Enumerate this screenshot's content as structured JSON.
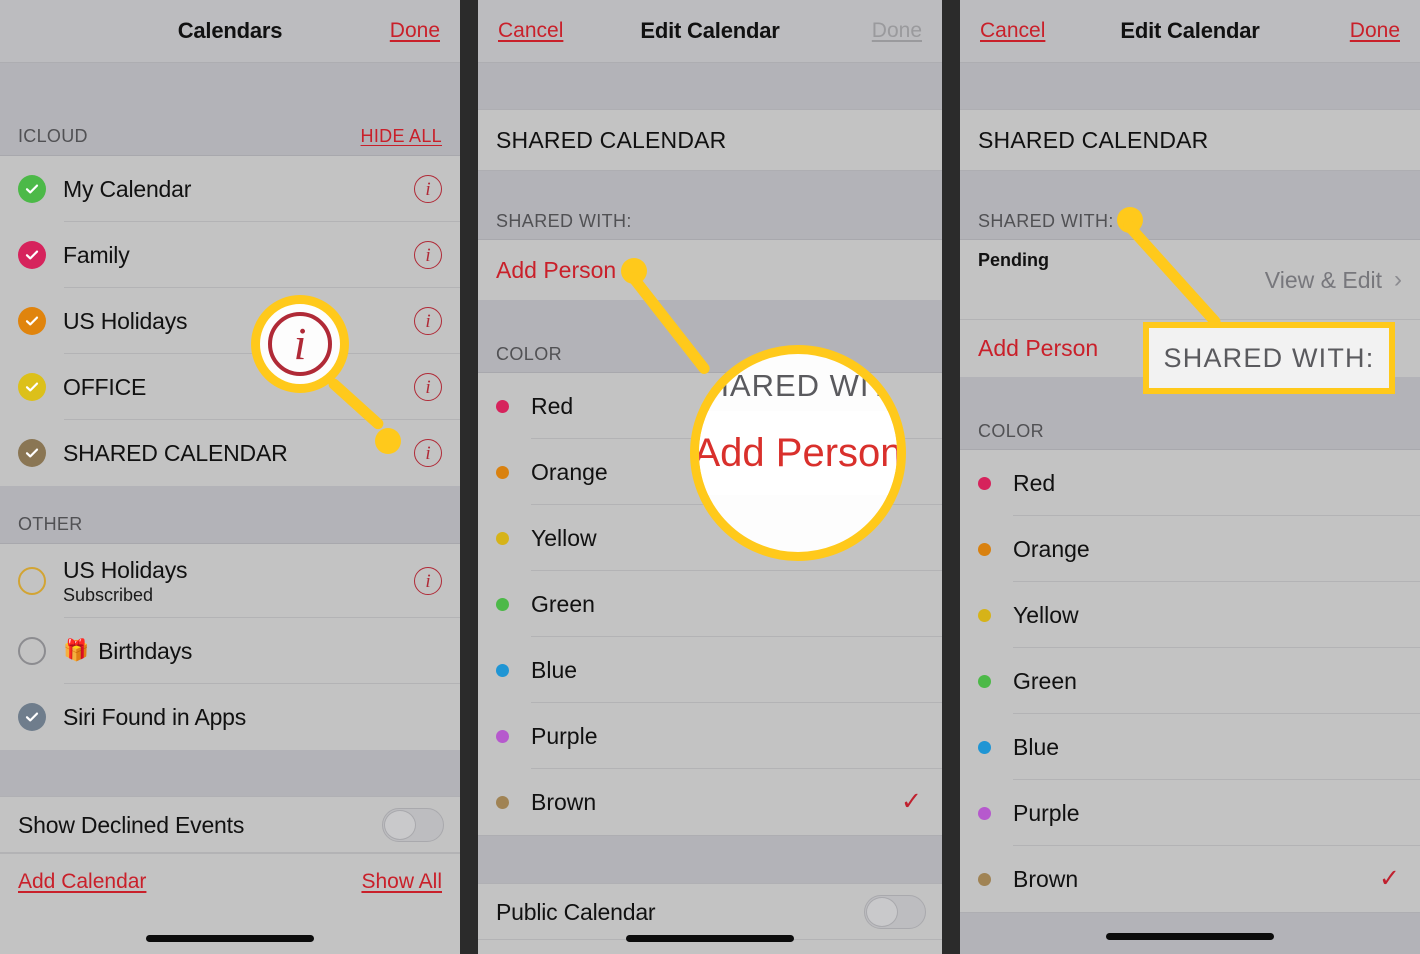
{
  "panel1": {
    "nav": {
      "title": "Calendars",
      "right_label": "Done"
    },
    "sections": [
      {
        "header_label": "ICLOUD",
        "header_action": "HIDE ALL",
        "rows": [
          {
            "label": "My Calendar",
            "color": "#4cb948",
            "checked": true,
            "info": "i"
          },
          {
            "label": "Family",
            "color": "#d6235c",
            "checked": true,
            "info": "i"
          },
          {
            "label": "US Holidays",
            "color": "#e0840d",
            "checked": true,
            "info": "i"
          },
          {
            "label": "OFFICE",
            "color": "#dcc01a",
            "checked": true,
            "info": "i"
          },
          {
            "label": "SHARED CALENDAR",
            "color": "#8a7654",
            "checked": true,
            "info": "i"
          }
        ]
      },
      {
        "header_label": "OTHER",
        "header_action": "",
        "rows": [
          {
            "label": "US Holidays",
            "sublabel": "Subscribed",
            "color": "#d2a433",
            "checked": false,
            "info": "i"
          },
          {
            "label": "Birthdays",
            "icon": "gift-icon",
            "color": "#8c8c90",
            "checked": false,
            "info": ""
          },
          {
            "label": "Siri Found in Apps",
            "color": "#6f7d8c",
            "checked": true,
            "info": ""
          }
        ]
      }
    ],
    "settings_row": {
      "label": "Show Declined Events",
      "toggle_on": false
    },
    "footer": {
      "left_link": "Add Calendar",
      "right_link": "Show All"
    }
  },
  "panel2": {
    "nav": {
      "left_label": "Cancel",
      "title": "Edit Calendar",
      "right_label": "Done",
      "right_disabled": true
    },
    "calendar_name": "SHARED CALENDAR",
    "shared_with_label": "SHARED WITH:",
    "add_person_label": "Add Person",
    "color_label": "COLOR",
    "colors": [
      {
        "name": "Red",
        "hex": "#d6235c",
        "selected": false
      },
      {
        "name": "Orange",
        "hex": "#d9810f",
        "selected": false
      },
      {
        "name": "Yellow",
        "hex": "#d6b318",
        "selected": false
      },
      {
        "name": "Green",
        "hex": "#4cb948",
        "selected": false
      },
      {
        "name": "Blue",
        "hex": "#1f95d4",
        "selected": false
      },
      {
        "name": "Purple",
        "hex": "#b659cd",
        "selected": false
      },
      {
        "name": "Brown",
        "hex": "#a08354",
        "selected": true
      }
    ],
    "public_calendar": {
      "label": "Public Calendar",
      "toggle_on": false
    },
    "check_mark": "✓"
  },
  "panel3": {
    "nav": {
      "left_label": "Cancel",
      "title": "Edit Calendar",
      "right_label": "Done",
      "right_disabled": false
    },
    "calendar_name": "SHARED CALENDAR",
    "shared_with_label": "SHARED WITH:",
    "person": {
      "name_redacted": "",
      "status": "Pending",
      "permission": "View & Edit",
      "chevron": "›"
    },
    "add_person_label": "Add Person",
    "color_label": "COLOR",
    "colors": [
      {
        "name": "Red",
        "hex": "#d6235c",
        "selected": false
      },
      {
        "name": "Orange",
        "hex": "#d9810f",
        "selected": false
      },
      {
        "name": "Yellow",
        "hex": "#d6b318",
        "selected": false
      },
      {
        "name": "Green",
        "hex": "#4cb948",
        "selected": false
      },
      {
        "name": "Blue",
        "hex": "#1f95d4",
        "selected": false
      },
      {
        "name": "Purple",
        "hex": "#b659cd",
        "selected": false
      },
      {
        "name": "Brown",
        "hex": "#a08354",
        "selected": true
      }
    ],
    "check_mark": "✓"
  },
  "annotations": {
    "accent_color": "#FFC91B",
    "magnifier_1": {
      "content": "info-icon",
      "glyph": "i"
    },
    "magnifier_2": {
      "top_text": "HARED WIT",
      "main_text": "Add Person"
    },
    "callout_3": {
      "text": "SHARED WITH:"
    }
  }
}
